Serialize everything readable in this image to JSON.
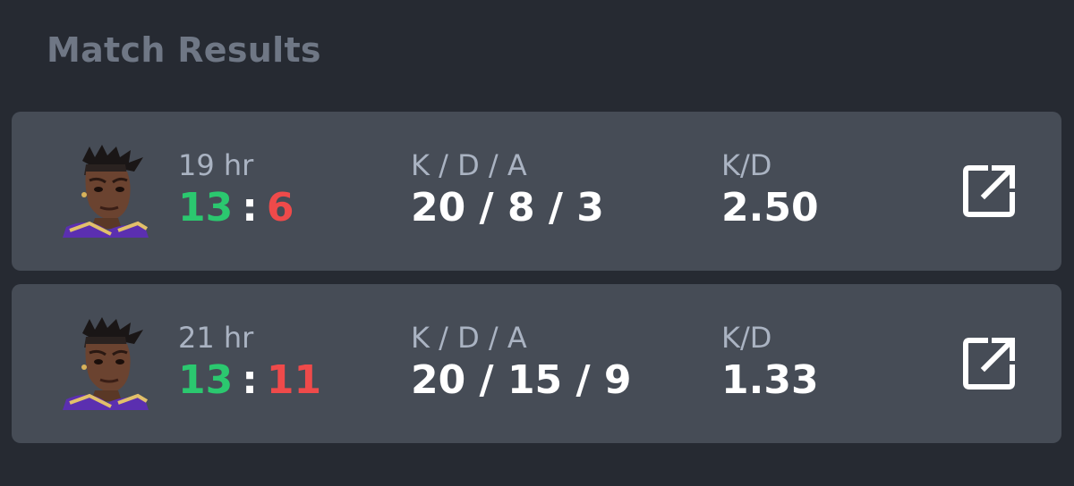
{
  "page": {
    "title": "Match Results"
  },
  "colors": {
    "background": "#262a32",
    "card": "#464c56",
    "win": "#2bc86f",
    "loss": "#ef4a4a",
    "label": "#aab3c2",
    "title": "#6f7785"
  },
  "matches": [
    {
      "time_ago": "19 hr",
      "score_team": "13",
      "score_separator": ":",
      "score_enemy": "6",
      "kda_label": "K / D / A",
      "kda": "20 / 8 / 3",
      "kd_label": "K/D",
      "kd": "2.50",
      "avatar_icon": "agent-portrait-icon",
      "action_icon": "open-external-icon"
    },
    {
      "time_ago": "21 hr",
      "score_team": "13",
      "score_separator": ":",
      "score_enemy": "11",
      "kda_label": "K / D / A",
      "kda": "20 / 15 / 9",
      "kd_label": "K/D",
      "kd": "1.33",
      "avatar_icon": "agent-portrait-icon",
      "action_icon": "open-external-icon"
    }
  ]
}
